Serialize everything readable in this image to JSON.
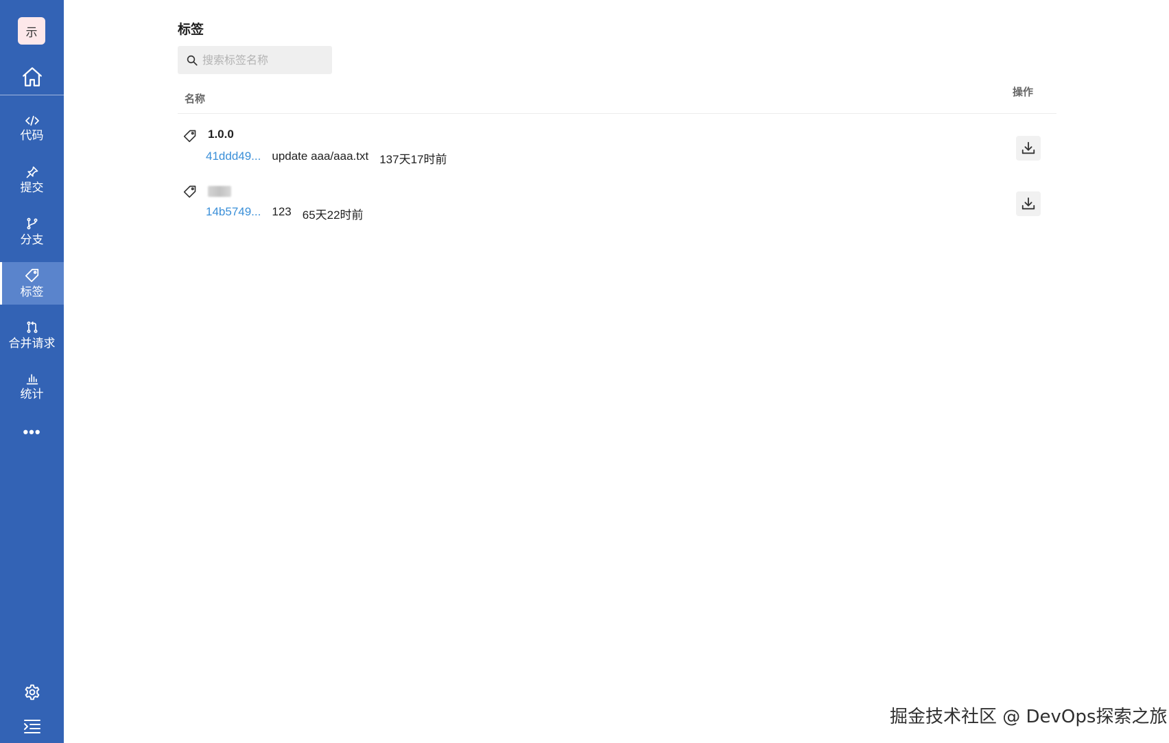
{
  "sidebar": {
    "logo_text": "示",
    "nav_items": [
      {
        "label": "代码",
        "icon": "code-icon"
      },
      {
        "label": "提交",
        "icon": "pin-icon"
      },
      {
        "label": "分支",
        "icon": "branch-icon"
      },
      {
        "label": "标签",
        "icon": "tag-icon",
        "active": true
      },
      {
        "label": "合并请求",
        "icon": "merge-request-icon"
      },
      {
        "label": "统计",
        "icon": "chart-icon"
      }
    ],
    "more": "•••"
  },
  "page": {
    "title": "标签",
    "search_placeholder": "搜索标签名称"
  },
  "table": {
    "col_name": "名称",
    "col_actions": "操作",
    "rows": [
      {
        "name": "1.0.0",
        "commit": "41ddd49...",
        "message": "update aaa/aaa.txt",
        "time": "137天17时前"
      },
      {
        "name": "",
        "name_redacted": true,
        "commit": "14b5749...",
        "message": "123",
        "time": "65天22时前"
      }
    ]
  },
  "colors": {
    "sidebar_bg": "#3363b5",
    "sidebar_active": "#5a84cc",
    "link": "#3a8fd8"
  },
  "watermark": "掘金技术社区 @ DevOps探索之旅"
}
